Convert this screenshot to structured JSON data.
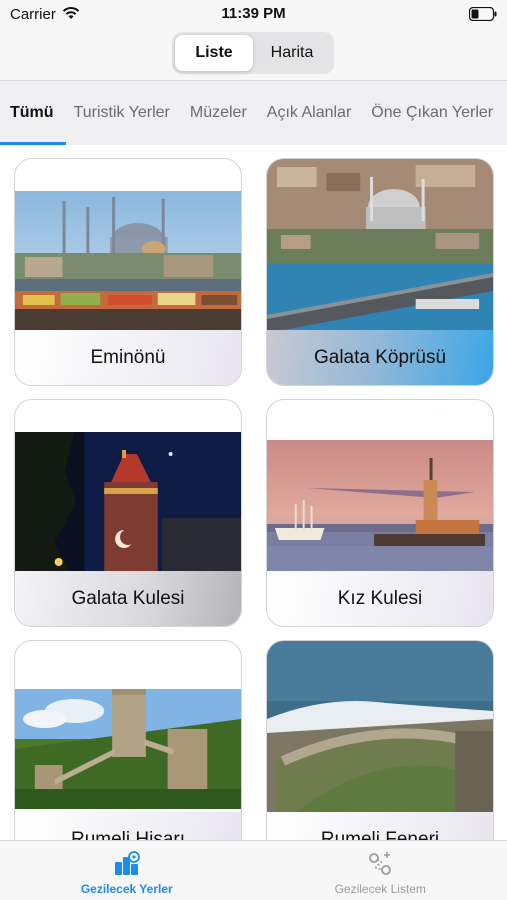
{
  "status_bar": {
    "carrier": "Carrier",
    "time": "11:39 PM"
  },
  "segmented": {
    "options": [
      "Liste",
      "Harita"
    ],
    "selected": "Liste"
  },
  "categories": {
    "tabs": [
      "Tümü",
      "Turistik Yerler",
      "Müzeler",
      "Açık Alanlar",
      "Öne Çıkan Yerler"
    ],
    "selected": "Tümü"
  },
  "places": [
    {
      "name": "Eminönü"
    },
    {
      "name": "Galata Köprüsü"
    },
    {
      "name": "Galata Kulesi"
    },
    {
      "name": "Kız Kulesi"
    },
    {
      "name": "Rumeli Hisarı"
    },
    {
      "name": "Rumeli Feneri"
    }
  ],
  "tab_bar": {
    "items": [
      {
        "label": "Gezilecek Yerler",
        "icon": "places-icon",
        "active": true
      },
      {
        "label": "Gezilecek Listem",
        "icon": "route-icon",
        "active": false
      }
    ]
  },
  "colors": {
    "accent": "#1a8cf0",
    "inactive": "#9a9aa0"
  }
}
